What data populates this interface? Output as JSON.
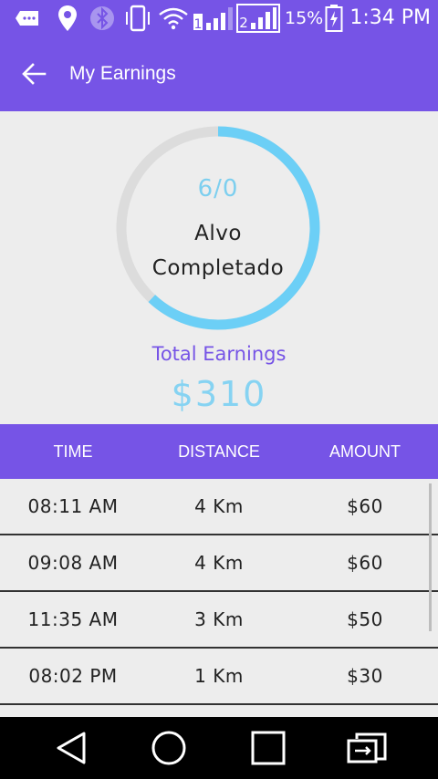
{
  "status_bar": {
    "battery_percent": "15%",
    "time": "1:34 PM",
    "icons": [
      "notification-icon",
      "location-icon",
      "bluetooth-icon",
      "vibrate-icon",
      "wifi-icon",
      "signal-sim1-icon",
      "signal-sim2-icon",
      "battery-icon"
    ],
    "sim1_label": "1",
    "sim2_label": "2"
  },
  "app_bar": {
    "title": "My Earnings",
    "color": "#7654e6"
  },
  "progress": {
    "count_text": "6/0",
    "label_line1": "Alvo",
    "label_line2": "Completado",
    "fraction": 0.62,
    "ring_color": "#6ccff6",
    "track_color": "#dcdcdc"
  },
  "earnings": {
    "label": "Total Earnings",
    "value": "$310"
  },
  "table": {
    "headers": [
      "TIME",
      "DISTANCE",
      "AMOUNT"
    ],
    "rows": [
      {
        "time": "08:11 AM",
        "distance": "4 Km",
        "amount": "$60"
      },
      {
        "time": "09:08 AM",
        "distance": "4 Km",
        "amount": "$60"
      },
      {
        "time": "11:35 AM",
        "distance": "3 Km",
        "amount": "$50"
      },
      {
        "time": "08:02 PM",
        "distance": "1 Km",
        "amount": "$30"
      }
    ]
  },
  "nav": {
    "buttons": [
      "back-triangle-icon",
      "home-circle-icon",
      "recents-square-icon",
      "dual-window-icon"
    ]
  }
}
